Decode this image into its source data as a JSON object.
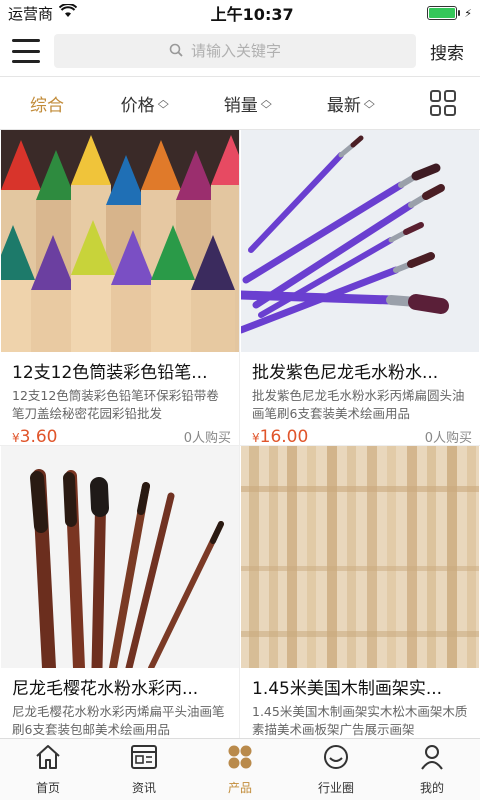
{
  "status": {
    "carrier": "运营商",
    "time": "上午10:37"
  },
  "header": {
    "search_placeholder": "请输入关键字",
    "search_button": "搜索"
  },
  "sort": {
    "items": [
      "综合",
      "价格",
      "销量",
      "最新"
    ],
    "active": "综合"
  },
  "products": [
    {
      "title": "12支12色筒装彩色铅笔...",
      "desc": "12支12色筒装彩色铅笔环保彩铅带卷笔刀盖绘秘密花园彩铅批发",
      "price_symbol": "¥",
      "price": "3.60",
      "buys": "0人购买"
    },
    {
      "title": "批发紫色尼龙毛水粉水...",
      "desc": "批发紫色尼龙毛水粉水彩丙烯扁圆头油画笔刷6支套装美术绘画用品",
      "price_symbol": "¥",
      "price": "16.00",
      "buys": "0人购买"
    },
    {
      "title": "尼龙毛樱花水粉水彩丙...",
      "desc": "尼龙毛樱花水粉水彩丙烯扁平头油画笔刷6支套装包邮美术绘画用品",
      "price_symbol": "",
      "price": "",
      "buys": ""
    },
    {
      "title": "1.45米美国木制画架实...",
      "desc": "1.45米美国木制画架实木松木画架木质素描美术画板架广告展示画架",
      "price_symbol": "",
      "price": "",
      "buys": ""
    }
  ],
  "tabs": [
    {
      "label": "首页",
      "icon": "home-icon"
    },
    {
      "label": "资讯",
      "icon": "news-icon"
    },
    {
      "label": "产品",
      "icon": "products-icon"
    },
    {
      "label": "行业圈",
      "icon": "circle-icon"
    },
    {
      "label": "我的",
      "icon": "user-icon"
    }
  ],
  "colors": {
    "accent": "#c28c3a",
    "price": "#e0552b"
  }
}
